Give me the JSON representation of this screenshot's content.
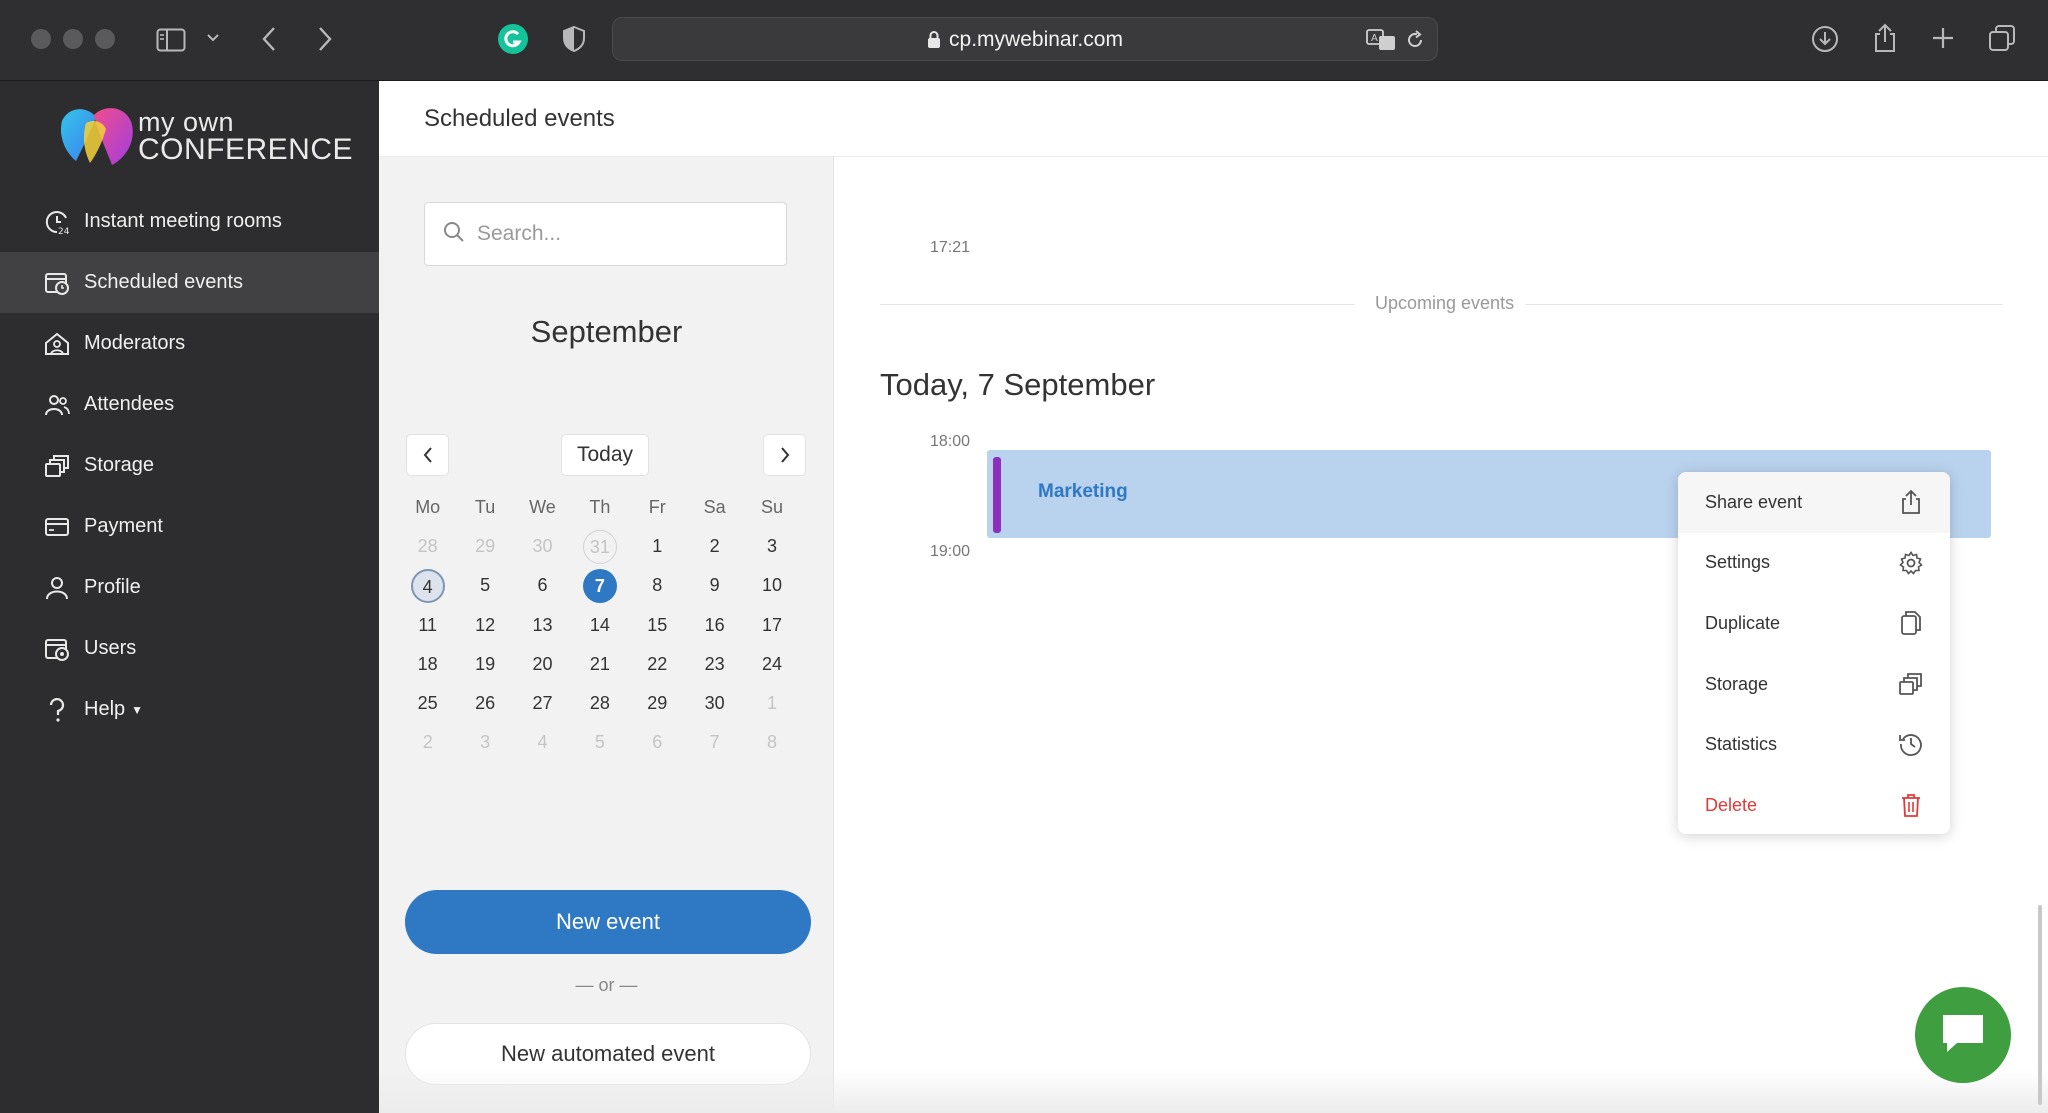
{
  "browser": {
    "url": "cp.mywebinar.com"
  },
  "brand": {
    "line1": "my own",
    "line2": "CONFERENCE"
  },
  "sidebar": {
    "items": [
      {
        "label": "Instant meeting rooms",
        "icon": "clock-24-icon"
      },
      {
        "label": "Scheduled events",
        "icon": "calendar-clock-icon",
        "active": true
      },
      {
        "label": "Moderators",
        "icon": "home-user-icon"
      },
      {
        "label": "Attendees",
        "icon": "users-icon"
      },
      {
        "label": "Storage",
        "icon": "storage-icon"
      },
      {
        "label": "Payment",
        "icon": "card-icon"
      },
      {
        "label": "Profile",
        "icon": "user-icon"
      },
      {
        "label": "Users",
        "icon": "users-gear-icon"
      },
      {
        "label": "Help",
        "icon": "question-icon"
      }
    ]
  },
  "page": {
    "title": "Scheduled events"
  },
  "calendar": {
    "search_placeholder": "Search...",
    "month": "September",
    "today_label": "Today",
    "weekdays": [
      "Mo",
      "Tu",
      "We",
      "Th",
      "Fr",
      "Sa",
      "Su"
    ],
    "weeks": [
      [
        "28",
        "29",
        "30",
        "31",
        "1",
        "2",
        "3"
      ],
      [
        "4",
        "5",
        "6",
        "7",
        "8",
        "9",
        "10"
      ],
      [
        "11",
        "12",
        "13",
        "14",
        "15",
        "16",
        "17"
      ],
      [
        "18",
        "19",
        "20",
        "21",
        "22",
        "23",
        "24"
      ],
      [
        "25",
        "26",
        "27",
        "28",
        "29",
        "30",
        "1"
      ],
      [
        "2",
        "3",
        "4",
        "5",
        "6",
        "7",
        "8"
      ]
    ],
    "new_event_label": "New event",
    "or_label": "— or —",
    "new_automated_label": "New automated event"
  },
  "schedule": {
    "time_top": "17:21",
    "upcoming_label": "Upcoming events",
    "day_title": "Today, 7 September",
    "time_start": "18:00",
    "time_end": "19:00",
    "event_name": "Marketing"
  },
  "context_menu": {
    "items": [
      {
        "label": "Share event",
        "icon": "share-icon"
      },
      {
        "label": "Settings",
        "icon": "gear-icon"
      },
      {
        "label": "Duplicate",
        "icon": "duplicate-icon"
      },
      {
        "label": "Storage",
        "icon": "storage-icon"
      },
      {
        "label": "Statistics",
        "icon": "history-icon"
      },
      {
        "label": "Delete",
        "icon": "trash-icon"
      }
    ]
  },
  "colors": {
    "accent": "#2f78c4",
    "event_bg": "#b9d2ee",
    "event_accent": "#8f2ebd",
    "danger": "#e23a3a",
    "chat": "#3f9e3f"
  }
}
